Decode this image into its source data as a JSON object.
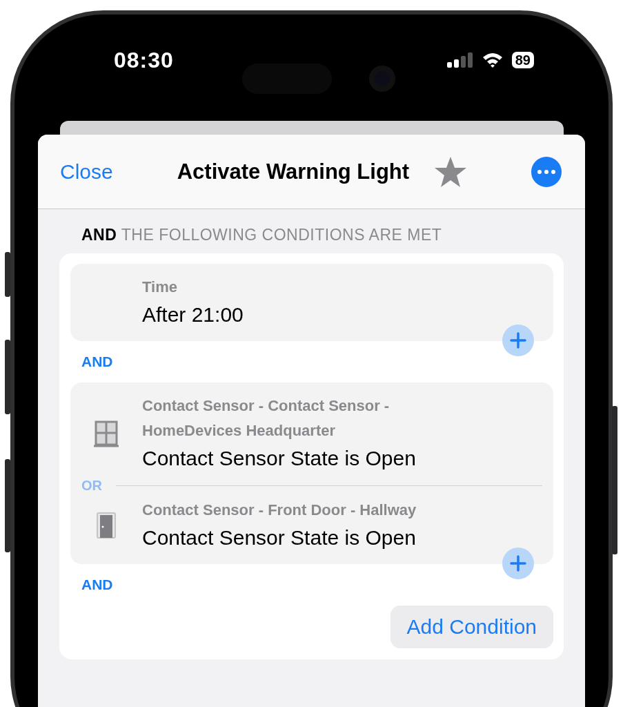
{
  "status_bar": {
    "time": "08:30",
    "battery": "89"
  },
  "header": {
    "close": "Close",
    "title": "Activate Warning Light"
  },
  "section_heading": "**AND** THE FOLLOWING CONDITIONS ARE MET",
  "condition_groups": [
    {
      "conditions": [
        {
          "label": "Time",
          "value": "After 21:00"
        }
      ],
      "joiner": "AND"
    },
    {
      "conditions": [
        {
          "kind": "window",
          "label": "Contact Sensor - Contact Sensor - HomeDevices Headquarter",
          "value": "Contact Sensor State is Open"
        },
        {
          "connector": "OR",
          "kind": "door",
          "label": "Contact Sensor - Front Door - Hallway",
          "value": "Contact Sensor State is Open"
        }
      ],
      "joiner": "AND"
    }
  ],
  "add_button": "Add Condition"
}
